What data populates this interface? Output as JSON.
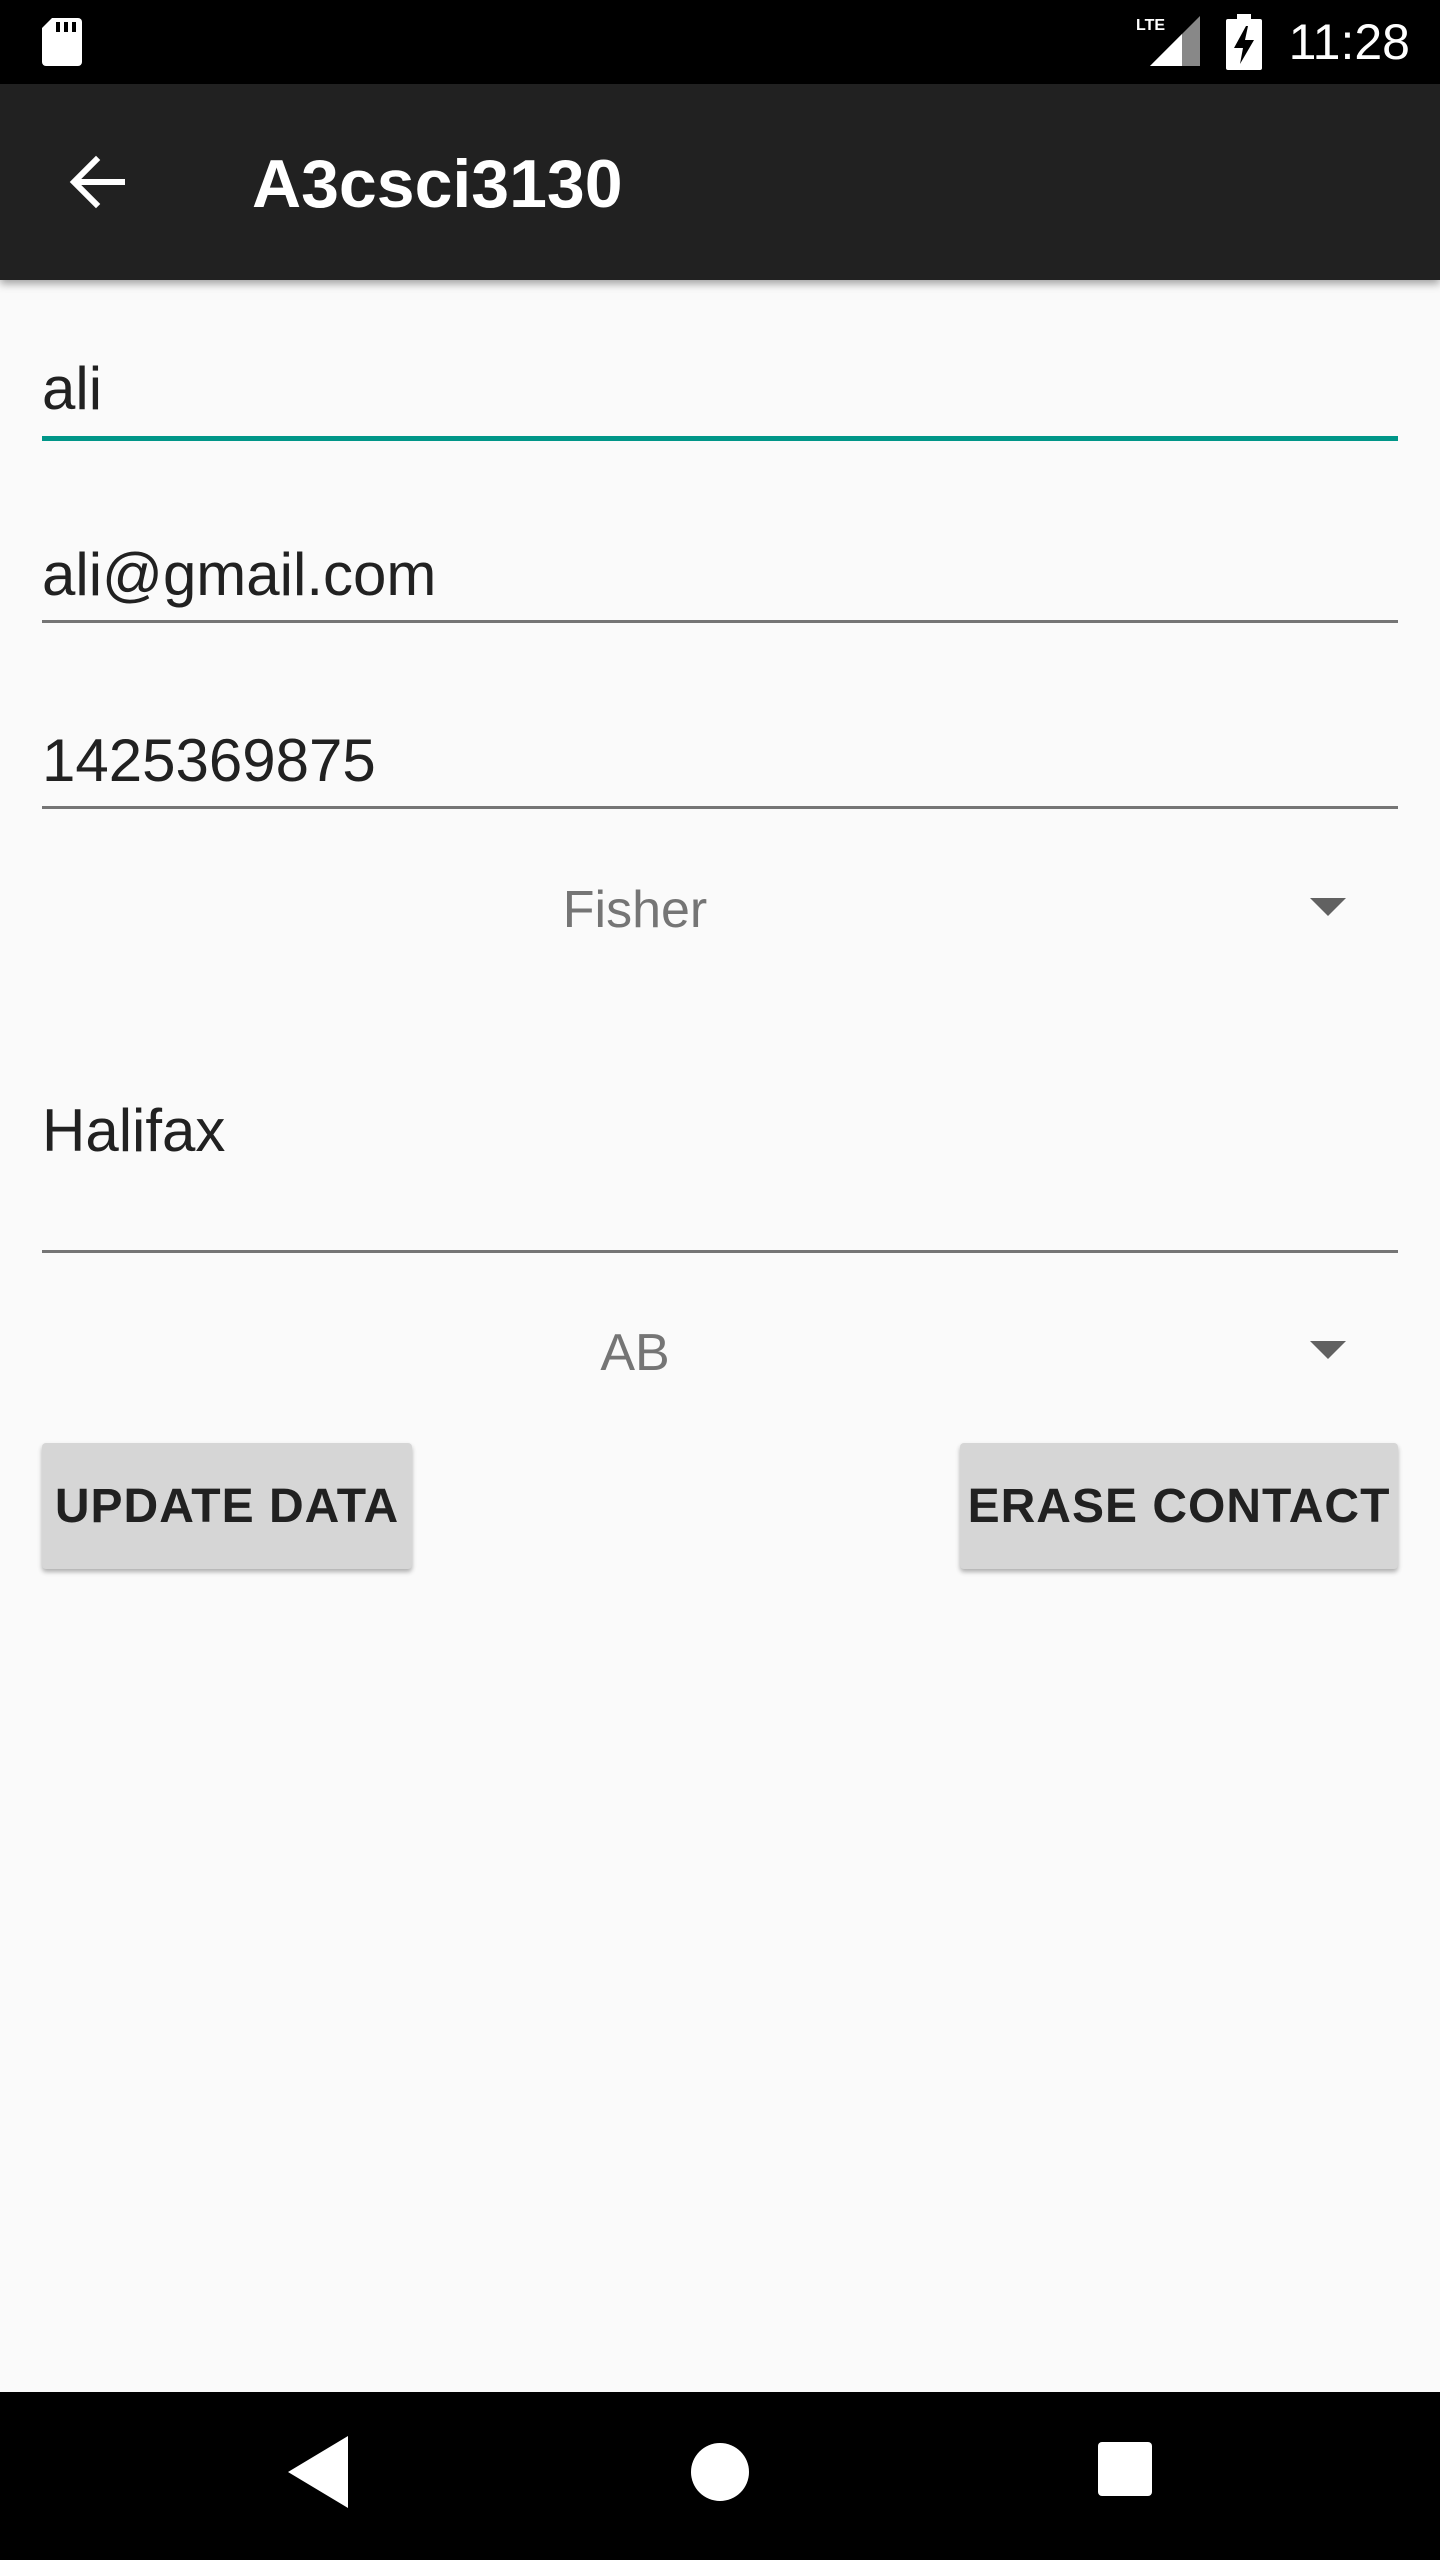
{
  "status_bar": {
    "time": "11:28",
    "network_label": "LTE",
    "icons": [
      "sd-card-icon",
      "signal-icon",
      "battery-charging-icon"
    ]
  },
  "app_bar": {
    "title": "A3csci3130",
    "back_icon": "arrow-back-icon"
  },
  "form": {
    "name_value": "ali",
    "email_value": "ali@gmail.com",
    "phone_value": "1425369875",
    "business_selected": "Fisher",
    "address_value": "Halifax",
    "province_selected": "AB"
  },
  "buttons": {
    "update_label": "UPDATE DATA",
    "erase_label": "ERASE CONTACT"
  },
  "nav_bar": {
    "icons": [
      "nav-back-icon",
      "nav-home-icon",
      "nav-recents-icon"
    ]
  },
  "colors": {
    "accent": "#009688",
    "app_bar": "#212121",
    "background": "#fafafa",
    "button": "#d6d6d6"
  }
}
